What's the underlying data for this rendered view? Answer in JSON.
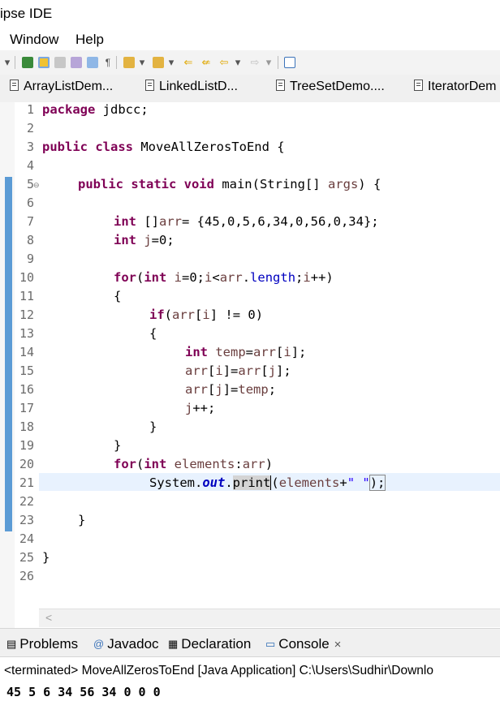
{
  "window": {
    "title": "ipse IDE"
  },
  "menu": {
    "window": "Window",
    "help": "Help"
  },
  "tabs": [
    {
      "label": "ArrayListDem..."
    },
    {
      "label": "LinkedListD..."
    },
    {
      "label": "TreeSetDemo...."
    },
    {
      "label": "IteratorDem"
    }
  ],
  "editor": {
    "line_numbers": [
      "1",
      "2",
      "3",
      "4",
      "5",
      "6",
      "7",
      "8",
      "9",
      "10",
      "11",
      "12",
      "13",
      "14",
      "15",
      "16",
      "17",
      "18",
      "19",
      "20",
      "21",
      "22",
      "23",
      "24",
      "25",
      "26"
    ],
    "lines": {
      "l1_kw": "package",
      "l1_rest": " jdbcc;",
      "l3_kw": "public class",
      "l3_rest": " MoveAllZerosToEnd {",
      "l5_kw": "public static void",
      "l5_rest": " main(String[] ",
      "l5_var": "args",
      "l5_end": ") {",
      "l7_kw": "int",
      "l7_a": " []",
      "l7_var": "arr",
      "l7_b": "= {45,0,5,6,34,0,56,0,34};",
      "l8_kw": "int",
      "l8_var": " j",
      "l8_b": "=0;",
      "l10_kw": "for",
      "l10_a": "(",
      "l10_kw2": "int",
      "l10_var": " i",
      "l10_b": "=0;",
      "l10_var2": "i",
      "l10_c": "<",
      "l10_var3": "arr",
      "l10_d": ".",
      "l10_fld": "length",
      "l10_e": ";",
      "l10_var4": "i",
      "l10_f": "++)",
      "l11": "{",
      "l12_kw": "if",
      "l12_a": "(",
      "l12_var": "arr",
      "l12_b": "[",
      "l12_var2": "i",
      "l12_c": "] != 0)",
      "l13": "{",
      "l14_kw": "int",
      "l14_var": " temp",
      "l14_a": "=",
      "l14_var2": "arr",
      "l14_b": "[",
      "l14_var3": "i",
      "l14_c": "];",
      "l15_var": "arr",
      "l15_a": "[",
      "l15_var2": "i",
      "l15_b": "]=",
      "l15_var3": "arr",
      "l15_c": "[",
      "l15_var4": "j",
      "l15_d": "];",
      "l16_var": "arr",
      "l16_a": "[",
      "l16_var2": "j",
      "l16_b": "]=",
      "l16_var3": "temp",
      "l16_c": ";",
      "l17_var": "j",
      "l17_a": "++;",
      "l18": "}",
      "l19": "}",
      "l20_kw": "for",
      "l20_a": "(",
      "l20_kw2": "int",
      "l20_var": " elements",
      "l20_b": ":",
      "l20_var2": "arr",
      "l20_c": ")",
      "l21_a": "System.",
      "l21_fld": "out",
      "l21_b": ".",
      "l21_sel": "print",
      "l21_c": "(",
      "l21_var": "elements",
      "l21_d": "+",
      "l21_str": "\" \"",
      "l21_e": ");",
      "l23": "}",
      "l25": "}"
    }
  },
  "bottom_panel": {
    "tabs": [
      {
        "label": "Problems"
      },
      {
        "label": "Javadoc"
      },
      {
        "label": "Declaration"
      },
      {
        "label": "Console"
      }
    ],
    "status": "<terminated> MoveAllZerosToEnd [Java Application] C:\\Users\\Sudhir\\Downlo",
    "output": "45 5 6 34 56 34 0 0 0"
  },
  "colors": {
    "keyword": "#7f0055",
    "field": "#0000c0",
    "variable": "#6a3e3e",
    "string": "#2a00ff",
    "change_bar": "#5b9bd5"
  }
}
